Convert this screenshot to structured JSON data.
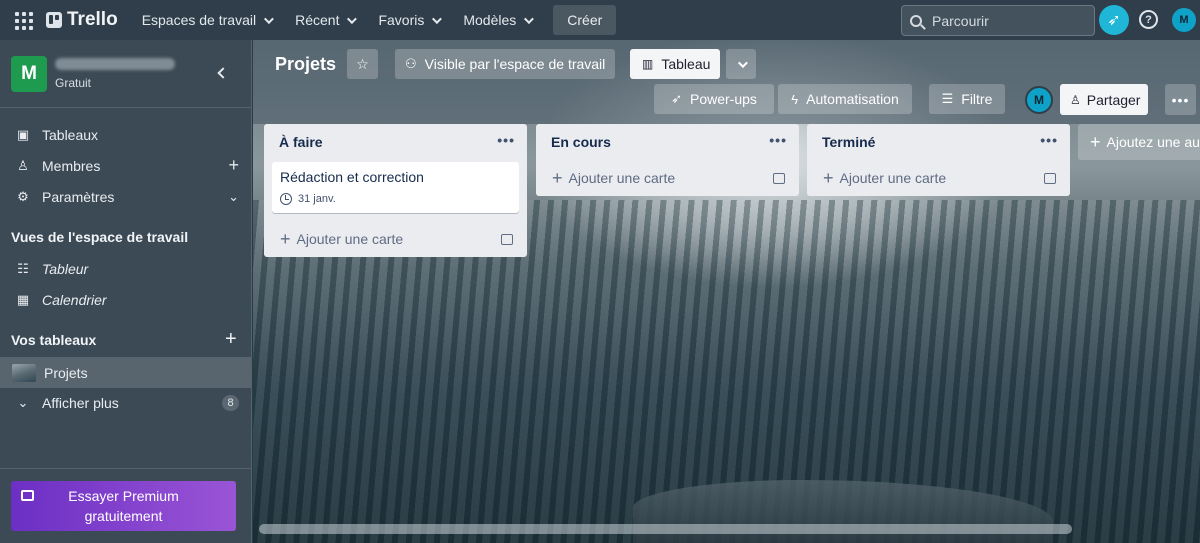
{
  "topbar": {
    "logo": "Trello",
    "nav": [
      "Espaces de travail",
      "Récent",
      "Favoris",
      "Modèles"
    ],
    "create": "Créer",
    "search_placeholder": "Parcourir",
    "avatar": "M",
    "help": "?"
  },
  "sidebar": {
    "workspace_initial": "M",
    "workspace_plan": "Gratuit",
    "items": [
      {
        "label": "Tableaux"
      },
      {
        "label": "Membres"
      },
      {
        "label": "Paramètres"
      }
    ],
    "views_heading": "Vues de l'espace de travail",
    "views": [
      {
        "label": "Tableur"
      },
      {
        "label": "Calendrier"
      }
    ],
    "boards_heading": "Vos tableaux",
    "boards": [
      {
        "label": "Projets"
      }
    ],
    "show_more": "Afficher plus",
    "show_more_count": "8",
    "premium": "Essayer Premium gratuitement"
  },
  "board": {
    "title": "Projets",
    "visibility": "Visible par l'espace de travail",
    "view": "Tableau",
    "powerups": "Power-ups",
    "automation": "Automatisation",
    "filter": "Filtre",
    "member": "M",
    "share": "Partager",
    "add_list": "Ajoutez une autre liste",
    "lists": [
      {
        "title": "À faire",
        "cards": [
          {
            "title": "Rédaction et correction",
            "date": "31 janv."
          }
        ],
        "add": "Ajouter une carte"
      },
      {
        "title": "En cours",
        "cards": [],
        "add": "Ajouter une carte"
      },
      {
        "title": "Terminé",
        "cards": [],
        "add": "Ajouter une carte"
      }
    ]
  },
  "colors": {
    "topbar": "#2f3e4a",
    "sidebar": "#3c4a56",
    "workspace_avatar": "#1e9b4f",
    "accent": "#1fb6d8",
    "premium_start": "#6c2fc4",
    "premium_end": "#9a55d6"
  }
}
